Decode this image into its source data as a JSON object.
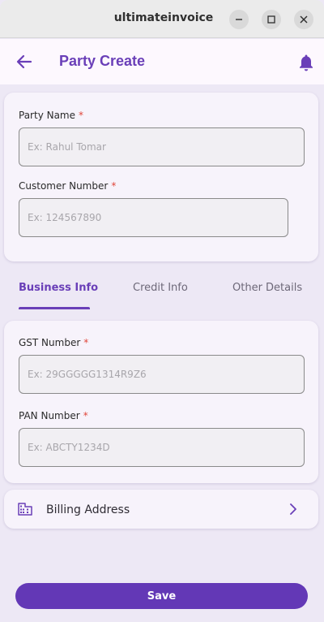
{
  "window": {
    "title": "ultimateinvoice"
  },
  "appbar": {
    "title": "Party Create"
  },
  "party": {
    "name_label": "Party Name",
    "name_placeholder": "Ex: Rahul Tomar",
    "customer_label": "Customer Number",
    "customer_placeholder": "Ex: 124567890",
    "required_mark": "*"
  },
  "tabs": [
    {
      "label": "Business Info",
      "active": true
    },
    {
      "label": "Credit Info",
      "active": false
    },
    {
      "label": "Other Details",
      "active": false
    }
  ],
  "business": {
    "gst_label": "GST Number",
    "gst_placeholder": "Ex: 29GGGGG1314R9Z6",
    "pan_label": "PAN Number",
    "pan_placeholder": "Ex: ABCTY1234D"
  },
  "billing": {
    "label": "Billing Address"
  },
  "actions": {
    "save_label": "Save"
  },
  "colors": {
    "accent": "#6a3fb8",
    "required": "#e0463a",
    "background": "#ede8f5"
  }
}
